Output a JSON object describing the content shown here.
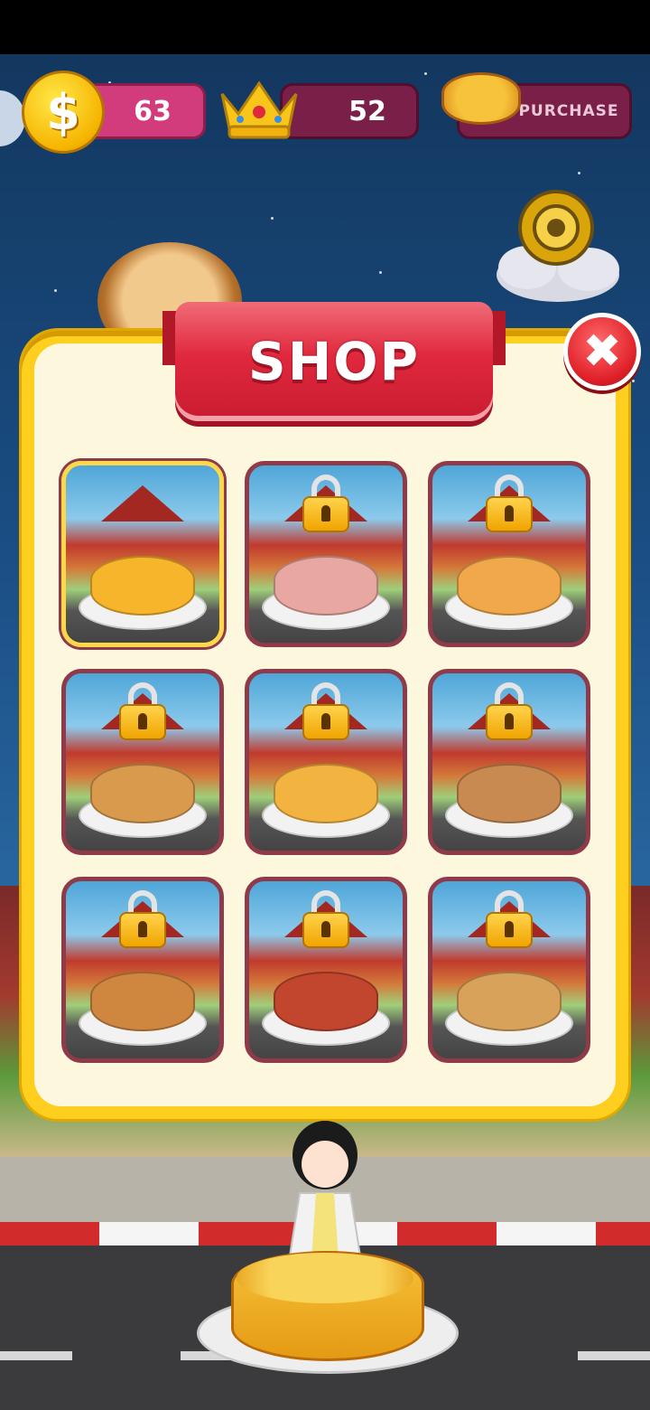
{
  "hud": {
    "coins": "63",
    "crowns": "52",
    "purchase_label": "PURCHASE"
  },
  "icons": {
    "coin": "coin-icon",
    "crown": "crown-icon",
    "pizza": "pizza-icon",
    "settings": "gear-icon",
    "close": "close-icon",
    "lock": "lock-icon"
  },
  "shop": {
    "title": "SHOP",
    "close_glyph": "✖",
    "items": [
      {
        "name": "pizza-cake",
        "locked": false,
        "selected": true,
        "food_color": "#f6b52a"
      },
      {
        "name": "veggie-pizza",
        "locked": true,
        "selected": false,
        "food_color": "#e8a7a0"
      },
      {
        "name": "caramel-cake",
        "locked": true,
        "selected": false,
        "food_color": "#f0a84a"
      },
      {
        "name": "burger-bun",
        "locked": true,
        "selected": false,
        "food_color": "#d99a4e"
      },
      {
        "name": "pancakes",
        "locked": true,
        "selected": false,
        "food_color": "#f3b340"
      },
      {
        "name": "sandwich",
        "locked": true,
        "selected": false,
        "food_color": "#c98a52"
      },
      {
        "name": "cheeseburger",
        "locked": true,
        "selected": false,
        "food_color": "#cf8740"
      },
      {
        "name": "hotdog",
        "locked": true,
        "selected": false,
        "food_color": "#c2452e"
      },
      {
        "name": "sub-sandwich",
        "locked": true,
        "selected": false,
        "food_color": "#d9a25a"
      }
    ]
  },
  "colors": {
    "panel": "#ffcf1f",
    "banner": "#e0283d",
    "coin_pill": "#d33c7c",
    "dark_pill": "#7a1f47"
  }
}
